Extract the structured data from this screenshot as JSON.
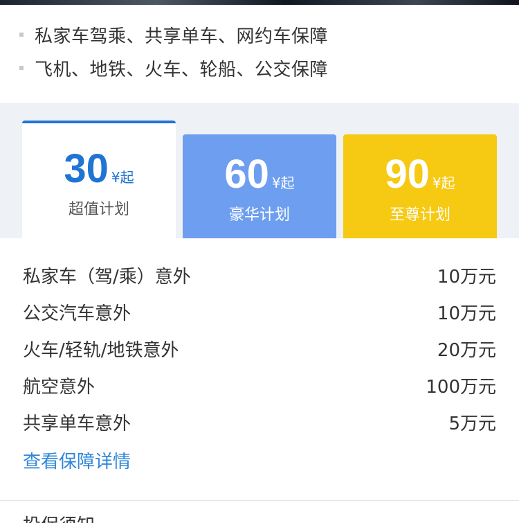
{
  "features": [
    "私家车驾乘、共享单车、网约车保障",
    "飞机、地铁、火车、轮船、公交保障"
  ],
  "plans": [
    {
      "price": "30",
      "unit": "¥起",
      "name": "超值计划",
      "selected": true,
      "color": "#1f74d4"
    },
    {
      "price": "60",
      "unit": "¥起",
      "name": "豪华计划",
      "selected": false,
      "color": "#6d9ef0"
    },
    {
      "price": "90",
      "unit": "¥起",
      "name": "至尊计划",
      "selected": false,
      "color": "#f6c912"
    }
  ],
  "coverage": [
    {
      "label": "私家车（驾/乘）意外",
      "amount": "10万元"
    },
    {
      "label": "公交汽车意外",
      "amount": "10万元"
    },
    {
      "label": "火车/轻轨/地铁意外",
      "amount": "20万元"
    },
    {
      "label": "航空意外",
      "amount": "100万元"
    },
    {
      "label": "共享单车意外",
      "amount": "5万元"
    }
  ],
  "details_link": "查看保障详情",
  "next_section_title": "投保须知"
}
